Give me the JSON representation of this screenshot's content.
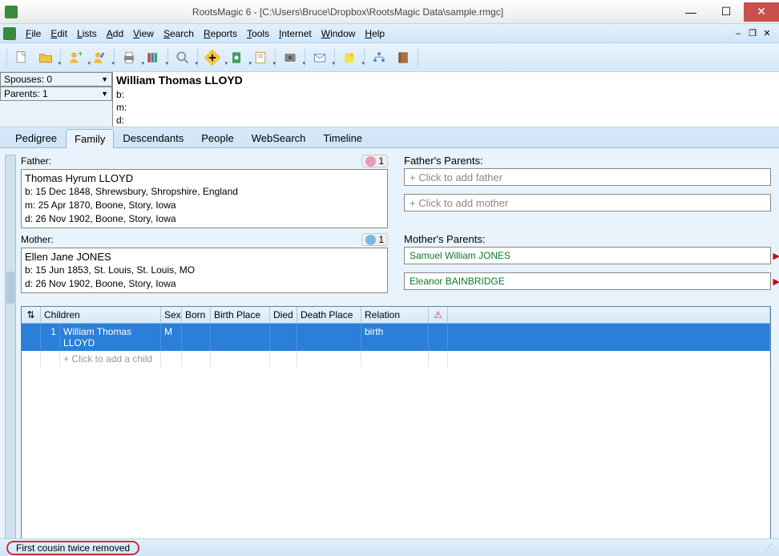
{
  "window": {
    "title": "RootsMagic 6 - [C:\\Users\\Bruce\\Dropbox\\RootsMagic Data\\sample.rmgc]"
  },
  "menu": [
    "File",
    "Edit",
    "Lists",
    "Add",
    "View",
    "Search",
    "Reports",
    "Tools",
    "Internet",
    "Window",
    "Help"
  ],
  "info": {
    "spouses_label": "Spouses: 0",
    "parents_label": "Parents: 1",
    "person_name": "William Thomas LLOYD",
    "b": "b:",
    "m": "m:",
    "d": "d:"
  },
  "tabs": [
    "Pedigree",
    "Family",
    "Descendants",
    "People",
    "WebSearch",
    "Timeline"
  ],
  "active_tab": 1,
  "father": {
    "label": "Father:",
    "badge": "1",
    "name": "Thomas Hyrum LLOYD",
    "b": "b: 15 Dec 1848, Shrewsbury, Shropshire, England",
    "m": "m: 25 Apr 1870, Boone, Story, Iowa",
    "d": "d: 26 Nov 1902, Boone, Story, Iowa"
  },
  "mother": {
    "label": "Mother:",
    "badge": "1",
    "name": "Ellen Jane JONES",
    "b": "b: 15 Jun 1853, St. Louis, St. Louis, MO",
    "d": "d: 26 Nov 1902, Boone, Story, Iowa"
  },
  "fathers_parents": {
    "label": "Father's Parents:",
    "add_father": "+ Click to add father",
    "add_mother": "+ Click to add mother"
  },
  "mothers_parents": {
    "label": "Mother's Parents:",
    "father": "Samuel William JONES",
    "mother": "Eleanor BAINBRIDGE"
  },
  "children_table": {
    "headers": {
      "sort": "⇅",
      "name": "Children",
      "sex": "Sex",
      "born": "Born",
      "bplace": "Birth Place",
      "died": "Died",
      "dplace": "Death Place",
      "rel": "Relation",
      "warn": "⚠"
    },
    "rows": [
      {
        "num": "1",
        "name": "William Thomas LLOYD",
        "sex": "M",
        "born": "",
        "bplace": "",
        "died": "",
        "dplace": "",
        "rel": "birth"
      }
    ],
    "add_child": "+ Click to add a child"
  },
  "status": "First cousin twice removed"
}
